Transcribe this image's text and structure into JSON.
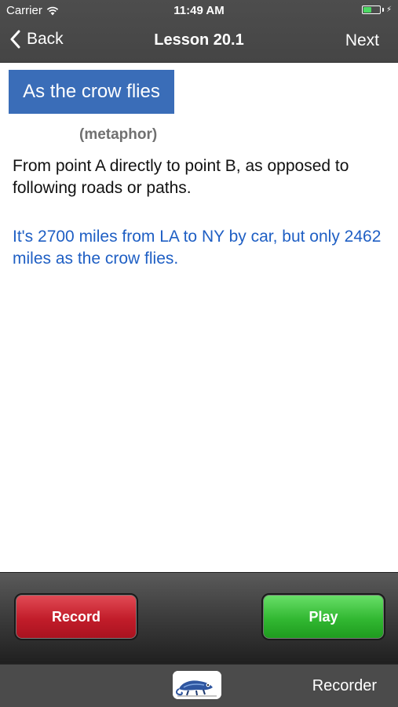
{
  "status_bar": {
    "carrier": "Carrier",
    "time": "11:49 AM",
    "battery_color": "#4cd964"
  },
  "nav": {
    "back_label": "Back",
    "title": "Lesson 20.1",
    "next_label": "Next"
  },
  "lesson": {
    "phrase": "As the crow flies",
    "phrase_bg": "#3a6db8",
    "type": "(metaphor)",
    "definition": "From point A directly to point B, as opposed to following roads or paths.",
    "example": "It's 2700 miles from LA to NY by car, but only 2462 miles as the crow flies.",
    "example_color": "#1f5fc4"
  },
  "controls": {
    "record_label": "Record",
    "record_color": "#c21d2a",
    "play_label": "Play",
    "play_color": "#32b832"
  },
  "tab_bar": {
    "app_icon": "chameleon-icon",
    "recorder_label": "Recorder"
  }
}
